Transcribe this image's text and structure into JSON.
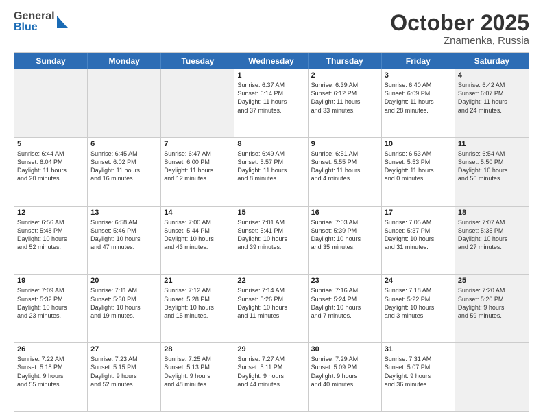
{
  "header": {
    "logo_general": "General",
    "logo_blue": "Blue",
    "month": "October 2025",
    "location": "Znamenka, Russia"
  },
  "days_of_week": [
    "Sunday",
    "Monday",
    "Tuesday",
    "Wednesday",
    "Thursday",
    "Friday",
    "Saturday"
  ],
  "weeks": [
    [
      {
        "day": "",
        "info": "",
        "shaded": true
      },
      {
        "day": "",
        "info": "",
        "shaded": true
      },
      {
        "day": "",
        "info": "",
        "shaded": true
      },
      {
        "day": "1",
        "info": "Sunrise: 6:37 AM\nSunset: 6:14 PM\nDaylight: 11 hours\nand 37 minutes.",
        "shaded": false
      },
      {
        "day": "2",
        "info": "Sunrise: 6:39 AM\nSunset: 6:12 PM\nDaylight: 11 hours\nand 33 minutes.",
        "shaded": false
      },
      {
        "day": "3",
        "info": "Sunrise: 6:40 AM\nSunset: 6:09 PM\nDaylight: 11 hours\nand 28 minutes.",
        "shaded": false
      },
      {
        "day": "4",
        "info": "Sunrise: 6:42 AM\nSunset: 6:07 PM\nDaylight: 11 hours\nand 24 minutes.",
        "shaded": true
      }
    ],
    [
      {
        "day": "5",
        "info": "Sunrise: 6:44 AM\nSunset: 6:04 PM\nDaylight: 11 hours\nand 20 minutes.",
        "shaded": false
      },
      {
        "day": "6",
        "info": "Sunrise: 6:45 AM\nSunset: 6:02 PM\nDaylight: 11 hours\nand 16 minutes.",
        "shaded": false
      },
      {
        "day": "7",
        "info": "Sunrise: 6:47 AM\nSunset: 6:00 PM\nDaylight: 11 hours\nand 12 minutes.",
        "shaded": false
      },
      {
        "day": "8",
        "info": "Sunrise: 6:49 AM\nSunset: 5:57 PM\nDaylight: 11 hours\nand 8 minutes.",
        "shaded": false
      },
      {
        "day": "9",
        "info": "Sunrise: 6:51 AM\nSunset: 5:55 PM\nDaylight: 11 hours\nand 4 minutes.",
        "shaded": false
      },
      {
        "day": "10",
        "info": "Sunrise: 6:53 AM\nSunset: 5:53 PM\nDaylight: 11 hours\nand 0 minutes.",
        "shaded": false
      },
      {
        "day": "11",
        "info": "Sunrise: 6:54 AM\nSunset: 5:50 PM\nDaylight: 10 hours\nand 56 minutes.",
        "shaded": true
      }
    ],
    [
      {
        "day": "12",
        "info": "Sunrise: 6:56 AM\nSunset: 5:48 PM\nDaylight: 10 hours\nand 52 minutes.",
        "shaded": false
      },
      {
        "day": "13",
        "info": "Sunrise: 6:58 AM\nSunset: 5:46 PM\nDaylight: 10 hours\nand 47 minutes.",
        "shaded": false
      },
      {
        "day": "14",
        "info": "Sunrise: 7:00 AM\nSunset: 5:44 PM\nDaylight: 10 hours\nand 43 minutes.",
        "shaded": false
      },
      {
        "day": "15",
        "info": "Sunrise: 7:01 AM\nSunset: 5:41 PM\nDaylight: 10 hours\nand 39 minutes.",
        "shaded": false
      },
      {
        "day": "16",
        "info": "Sunrise: 7:03 AM\nSunset: 5:39 PM\nDaylight: 10 hours\nand 35 minutes.",
        "shaded": false
      },
      {
        "day": "17",
        "info": "Sunrise: 7:05 AM\nSunset: 5:37 PM\nDaylight: 10 hours\nand 31 minutes.",
        "shaded": false
      },
      {
        "day": "18",
        "info": "Sunrise: 7:07 AM\nSunset: 5:35 PM\nDaylight: 10 hours\nand 27 minutes.",
        "shaded": true
      }
    ],
    [
      {
        "day": "19",
        "info": "Sunrise: 7:09 AM\nSunset: 5:32 PM\nDaylight: 10 hours\nand 23 minutes.",
        "shaded": false
      },
      {
        "day": "20",
        "info": "Sunrise: 7:11 AM\nSunset: 5:30 PM\nDaylight: 10 hours\nand 19 minutes.",
        "shaded": false
      },
      {
        "day": "21",
        "info": "Sunrise: 7:12 AM\nSunset: 5:28 PM\nDaylight: 10 hours\nand 15 minutes.",
        "shaded": false
      },
      {
        "day": "22",
        "info": "Sunrise: 7:14 AM\nSunset: 5:26 PM\nDaylight: 10 hours\nand 11 minutes.",
        "shaded": false
      },
      {
        "day": "23",
        "info": "Sunrise: 7:16 AM\nSunset: 5:24 PM\nDaylight: 10 hours\nand 7 minutes.",
        "shaded": false
      },
      {
        "day": "24",
        "info": "Sunrise: 7:18 AM\nSunset: 5:22 PM\nDaylight: 10 hours\nand 3 minutes.",
        "shaded": false
      },
      {
        "day": "25",
        "info": "Sunrise: 7:20 AM\nSunset: 5:20 PM\nDaylight: 9 hours\nand 59 minutes.",
        "shaded": true
      }
    ],
    [
      {
        "day": "26",
        "info": "Sunrise: 7:22 AM\nSunset: 5:18 PM\nDaylight: 9 hours\nand 55 minutes.",
        "shaded": false
      },
      {
        "day": "27",
        "info": "Sunrise: 7:23 AM\nSunset: 5:15 PM\nDaylight: 9 hours\nand 52 minutes.",
        "shaded": false
      },
      {
        "day": "28",
        "info": "Sunrise: 7:25 AM\nSunset: 5:13 PM\nDaylight: 9 hours\nand 48 minutes.",
        "shaded": false
      },
      {
        "day": "29",
        "info": "Sunrise: 7:27 AM\nSunset: 5:11 PM\nDaylight: 9 hours\nand 44 minutes.",
        "shaded": false
      },
      {
        "day": "30",
        "info": "Sunrise: 7:29 AM\nSunset: 5:09 PM\nDaylight: 9 hours\nand 40 minutes.",
        "shaded": false
      },
      {
        "day": "31",
        "info": "Sunrise: 7:31 AM\nSunset: 5:07 PM\nDaylight: 9 hours\nand 36 minutes.",
        "shaded": false
      },
      {
        "day": "",
        "info": "",
        "shaded": true
      }
    ]
  ]
}
